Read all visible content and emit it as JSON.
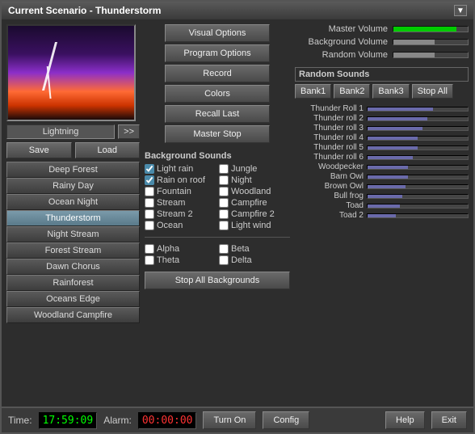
{
  "window": {
    "title": "Current Scenario - Thunderstorm",
    "minimize_btn": "▼"
  },
  "preview": {
    "label": "Lightning",
    "arrow_btn": ">>"
  },
  "left_buttons": {
    "save": "Save",
    "load": "Load",
    "scenarios": [
      {
        "label": "Deep Forest",
        "active": false
      },
      {
        "label": "Rainy Day",
        "active": false
      },
      {
        "label": "Ocean Night",
        "active": false
      },
      {
        "label": "Thunderstorm",
        "active": true
      },
      {
        "label": "Night Stream",
        "active": false
      },
      {
        "label": "Forest Stream",
        "active": false
      },
      {
        "label": "Dawn Chorus",
        "active": false
      },
      {
        "label": "Rainforest",
        "active": false
      },
      {
        "label": "Oceans Edge",
        "active": false
      },
      {
        "label": "Woodland Campfire",
        "active": false
      }
    ]
  },
  "top_buttons": {
    "visual_options": "Visual Options",
    "program_options": "Program Options",
    "record": "Record",
    "colors": "Colors",
    "recall_last": "Recall Last",
    "master_stop": "Master Stop"
  },
  "bg_sounds": {
    "label": "Background Sounds",
    "items": [
      {
        "label": "Light rain",
        "checked": true,
        "col": 0
      },
      {
        "label": "Jungle",
        "checked": false,
        "col": 1
      },
      {
        "label": "Rain on roof",
        "checked": true,
        "col": 0
      },
      {
        "label": "Night",
        "checked": false,
        "col": 1
      },
      {
        "label": "Fountain",
        "checked": false,
        "col": 0
      },
      {
        "label": "Woodland",
        "checked": false,
        "col": 1
      },
      {
        "label": "Stream",
        "checked": false,
        "col": 0
      },
      {
        "label": "Campfire",
        "checked": false,
        "col": 1
      },
      {
        "label": "Stream 2",
        "checked": false,
        "col": 0
      },
      {
        "label": "Campfire 2",
        "checked": false,
        "col": 1
      },
      {
        "label": "Ocean",
        "checked": false,
        "col": 0
      },
      {
        "label": "Light wind",
        "checked": false,
        "col": 1
      }
    ],
    "brain_items": [
      {
        "label": "Alpha",
        "checked": false
      },
      {
        "label": "Beta",
        "checked": false
      },
      {
        "label": "Theta",
        "checked": false
      },
      {
        "label": "Delta",
        "checked": false
      }
    ],
    "stop_all_btn": "Stop All Backgrounds"
  },
  "volumes": {
    "master_label": "Master Volume",
    "bg_label": "Background Volume",
    "random_label": "Random Volume",
    "master_pct": 85,
    "bg_pct": 55,
    "random_pct": 55
  },
  "random_sounds": {
    "label": "Random Sounds",
    "bank1": "Bank1",
    "bank2": "Bank2",
    "bank3": "Bank3",
    "stop_all": "Stop All",
    "sounds": [
      {
        "name": "Thunder Roll 1",
        "pct": 65
      },
      {
        "name": "Thunder roll 2",
        "pct": 60
      },
      {
        "name": "Thunder roll 3",
        "pct": 55
      },
      {
        "name": "Thunder roll 4",
        "pct": 50
      },
      {
        "name": "Thunder roll 5",
        "pct": 50
      },
      {
        "name": "Thunder roll 6",
        "pct": 45
      },
      {
        "name": "Woodpecker",
        "pct": 40
      },
      {
        "name": "Barn Owl",
        "pct": 40
      },
      {
        "name": "Brown Owl",
        "pct": 38
      },
      {
        "name": "Bull frog",
        "pct": 35
      },
      {
        "name": "Toad",
        "pct": 32
      },
      {
        "name": "Toad 2",
        "pct": 28
      }
    ]
  },
  "bottom": {
    "time_label": "Time:",
    "time_value": "17:59:09",
    "alarm_label": "Alarm:",
    "alarm_value": "00:00:00",
    "turn_on": "Turn On",
    "config": "Config",
    "help": "Help",
    "exit": "Exit"
  }
}
